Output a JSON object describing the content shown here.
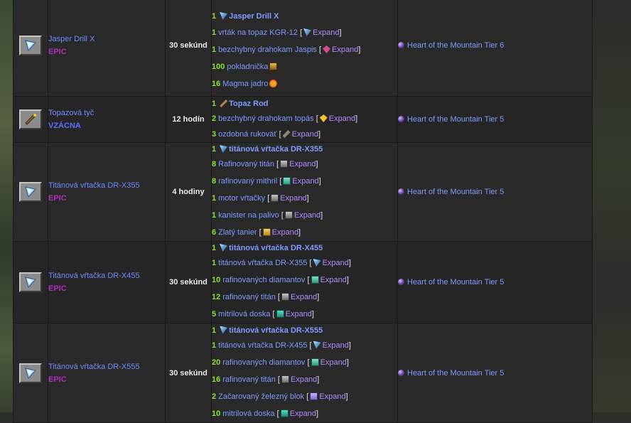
{
  "rows": [
    {
      "name": "Jasper Drill X",
      "rarity": "EPIC",
      "rarity_class": "epic",
      "time": "30 sekúnd",
      "head": {
        "qty": "1",
        "name": "Jasper Drill X"
      },
      "ingredients": [
        {
          "qty": "1",
          "name": "vrták na topaz KGR-12",
          "icon": "drill-icon",
          "expand": "Expand"
        },
        {
          "qty": "1",
          "name": "bezchybný drahokam Jaspis",
          "icon": "gem-icon",
          "expand": "Expand"
        },
        {
          "qty": "100",
          "name": "pokladnička",
          "icon": "chest-icon"
        },
        {
          "qty": "16",
          "name": "Magma jadro",
          "icon": "magma-icon"
        }
      ],
      "requirement": "Heart of the Mountain Tier 6"
    },
    {
      "name": "Topazová tyč",
      "rarity": "VZÁCNA",
      "rarity_class": "rare",
      "time": "12 hodín",
      "head": {
        "qty": "1",
        "name": "Topaz Rod"
      },
      "ingredients": [
        {
          "qty": "2",
          "name": "bezchybný drahokam topás",
          "icon": "gem-icon",
          "expand": "Expand"
        },
        {
          "qty": "3",
          "name": "ozdobná rukoväť",
          "icon": "handle-icon",
          "expand": "Expand"
        }
      ],
      "requirement": "Heart of the Mountain Tier 5"
    },
    {
      "name": "Titánová vŕtačka DR-X355",
      "rarity": "EPIC",
      "rarity_class": "epic",
      "time": "4 hodiny",
      "head": {
        "qty": "1",
        "name": "titánová vŕtačka DR-X355"
      },
      "ingredients": [
        {
          "qty": "8",
          "name": "Rafinovaný titán",
          "icon": "block-icon",
          "expand": "Expand"
        },
        {
          "qty": "8",
          "name": "rafinovaný mithril",
          "icon": "block-icon",
          "expand": "Expand"
        },
        {
          "qty": "1",
          "name": "motor vŕtačky",
          "icon": "block-icon",
          "expand": "Expand"
        },
        {
          "qty": "1",
          "name": "kanister na palivo",
          "icon": "block-icon",
          "expand": "Expand"
        },
        {
          "qty": "6",
          "name": "Zlatý tanier",
          "icon": "block-icon",
          "expand": "Expand"
        }
      ],
      "requirement": "Heart of the Mountain Tier 5"
    },
    {
      "name": "Titánová vŕtačka DR-X455",
      "rarity": "EPIC",
      "rarity_class": "epic",
      "time": "30 sekúnd",
      "head": {
        "qty": "1",
        "name": "titánová vŕtačka DR-X455"
      },
      "ingredients": [
        {
          "qty": "1",
          "name": "titánová vŕtačka DR-X355",
          "icon": "drill-icon",
          "expand": "Expand"
        },
        {
          "qty": "10",
          "name": "rafinovaných diamantov",
          "icon": "block-icon",
          "expand": "Expand"
        },
        {
          "qty": "12",
          "name": "rafinovaný titán",
          "icon": "block-icon",
          "expand": "Expand"
        },
        {
          "qty": "5",
          "name": "mitrilová doska",
          "icon": "block-icon",
          "expand": "Expand"
        }
      ],
      "requirement": "Heart of the Mountain Tier 5"
    },
    {
      "name": "Titánová vŕtačka DR-X555",
      "rarity": "EPIC",
      "rarity_class": "epic",
      "time": "30 sekúnd",
      "head": {
        "qty": "1",
        "name": "titánová vŕtačka DR-X555"
      },
      "ingredients": [
        {
          "qty": "1",
          "name": "titánová vŕtačka DR-X455",
          "icon": "drill-icon",
          "expand": "Expand"
        },
        {
          "qty": "20",
          "name": "rafinovaných diamantov",
          "icon": "block-icon",
          "expand": "Expand"
        },
        {
          "qty": "16",
          "name": "rafinovaný titán",
          "icon": "block-icon",
          "expand": "Expand"
        },
        {
          "qty": "2",
          "name": "Začarovaný železný blok",
          "icon": "block-icon",
          "expand": "Expand"
        },
        {
          "qty": "10",
          "name": "mitrilová doska",
          "icon": "block-icon",
          "expand": "Expand"
        }
      ],
      "requirement": "Heart of the Mountain Tier 5"
    }
  ]
}
